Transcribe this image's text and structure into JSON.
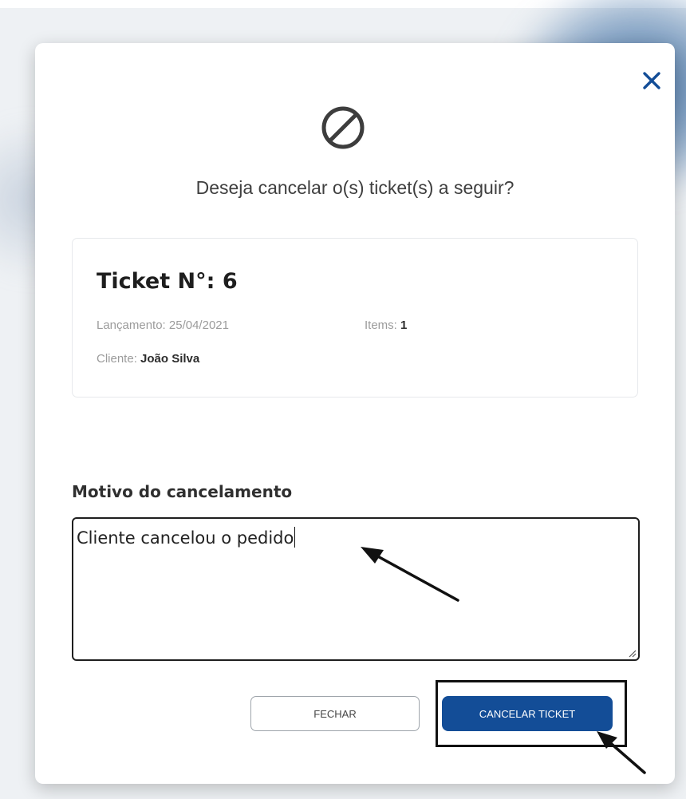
{
  "dialog": {
    "question": "Deseja cancelar o(s) ticket(s) a seguir?",
    "close_icon": "close-icon",
    "hero_icon": "prohibited-icon",
    "accent_color": "#134d97"
  },
  "ticket": {
    "title": "Ticket N°: 6",
    "launch_label": "Lançamento: 25/04/2021",
    "items_label": "Items:",
    "items_value": "1",
    "client_label": "Cliente:",
    "client_value": "João Silva"
  },
  "reason": {
    "label": "Motivo do cancelamento",
    "value": "Cliente cancelou o pedido"
  },
  "actions": {
    "close_label": "FECHAR",
    "cancel_label": "CANCELAR TICKET"
  }
}
